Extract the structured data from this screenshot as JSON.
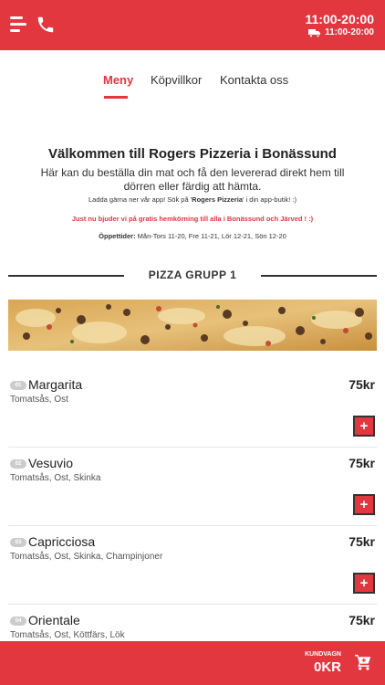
{
  "header": {
    "hours_main": "11:00-20:00",
    "delivery_hours": "11:00-20:00",
    "icons": [
      "menu-icon",
      "phone-icon",
      "truck-icon"
    ]
  },
  "tabs": [
    {
      "label": "Meny",
      "active": true
    },
    {
      "label": "Köpvillkor",
      "active": false
    },
    {
      "label": "Kontakta oss",
      "active": false
    }
  ],
  "welcome": {
    "title": "Välkommen till Rogers Pizzeria i Bonässund",
    "intro": "Här kan du beställa din mat och få den levererad direkt hem till dörren eller färdig att hämta.",
    "app_note_prefix": "Ladda gärna ner vår app! Sök på '",
    "app_note_bold": "Rogers Pizzeria",
    "app_note_suffix": "' i din app-butik! :)",
    "promo": "Just nu bjuder vi på gratis hemkörning till alla i Bonässund och Järved ! :)",
    "hours_label": "Öppettider:",
    "hours_text": " Mån-Tors 11-20, Fre 11-21, Lör 12-21, Sön 12-20"
  },
  "section": {
    "title": "PIZZA GRUPP 1"
  },
  "menu_items": [
    {
      "num": "01",
      "name": "Margarita",
      "desc": "Tomatsås, Ost",
      "price": "75kr"
    },
    {
      "num": "02",
      "name": "Vesuvio",
      "desc": "Tomatsås, Ost, Skinka",
      "price": "75kr"
    },
    {
      "num": "03",
      "name": "Capricciosa",
      "desc": "Tomatsås, Ost, Skinka, Champinjoner",
      "price": "75kr"
    },
    {
      "num": "04",
      "name": "Orientale",
      "desc": "Tomatsås, Ost, Köttfärs, Lök",
      "price": "75kr"
    }
  ],
  "add_label": "+",
  "cart": {
    "label": "KUNDVAGN",
    "total": "0KR"
  },
  "colors": {
    "brand_red": "#e2373f",
    "dark": "#333333"
  }
}
